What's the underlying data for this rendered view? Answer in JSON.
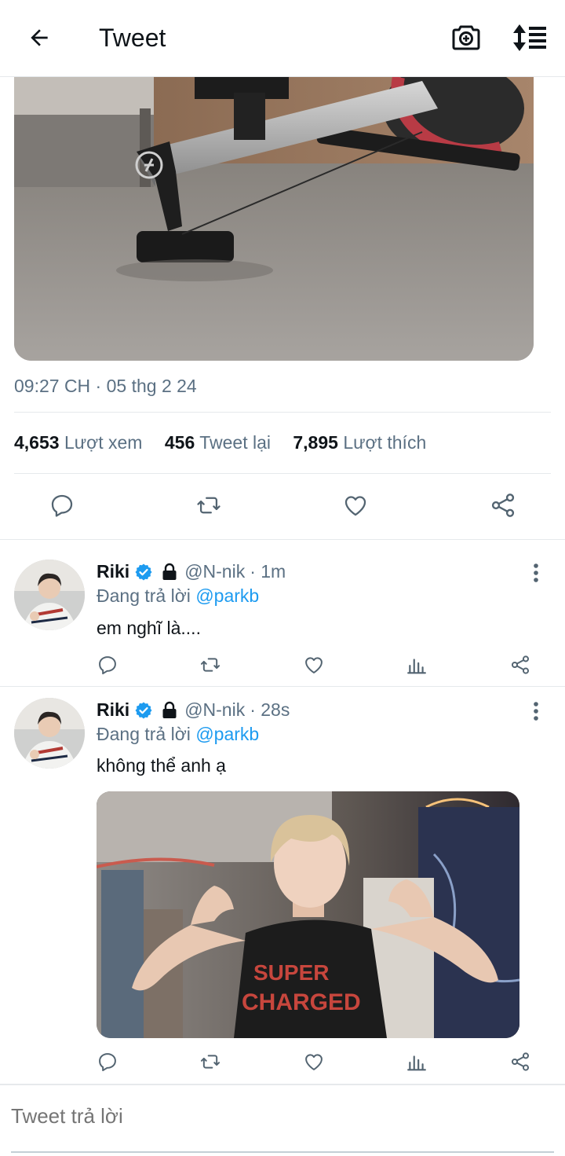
{
  "header": {
    "title": "Tweet",
    "back_icon": "arrow-left-icon",
    "camera_icon": "camera-plus-icon",
    "sort_icon": "sort-lines-icon"
  },
  "main_tweet": {
    "timestamp": "09:27 CH · 05 thg 2 24",
    "stats": {
      "views_count": "4,653",
      "views_label": "Lượt xem",
      "retweets_count": "456",
      "retweets_label": "Tweet lại",
      "likes_count": "7,895",
      "likes_label": "Lượt thích"
    }
  },
  "replies": [
    {
      "name": "Riki",
      "handle": "@N-nik",
      "time": "· 1m",
      "replying_prefix": "Đang trả lời",
      "replying_to": "@parkb",
      "text": "em nghĩ là...."
    },
    {
      "name": "Riki",
      "handle": "@N-nik",
      "time": "· 28s",
      "replying_prefix": "Đang trả lời",
      "replying_to": "@parkb",
      "text": "không thể anh ạ"
    }
  ],
  "compose": {
    "placeholder": "Tweet trả lời"
  },
  "colors": {
    "accent": "#1d9bf0",
    "secondary_text": "#5b7083",
    "icon": "#536471",
    "divider": "#e6e9ec"
  }
}
